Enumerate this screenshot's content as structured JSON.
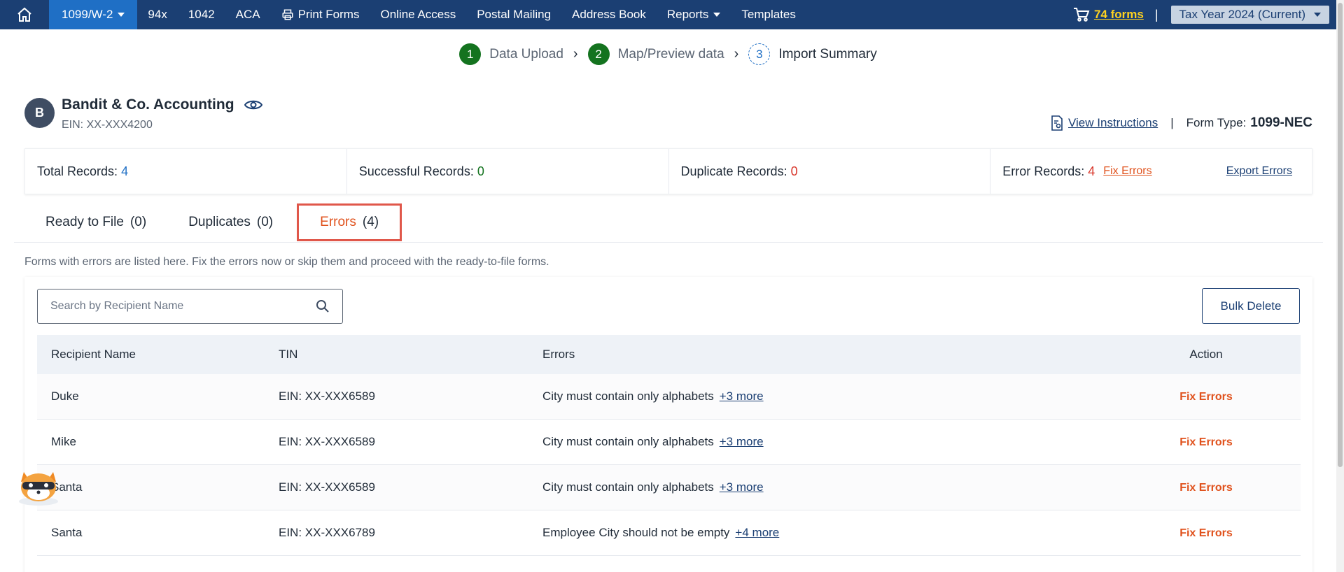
{
  "nav": {
    "active_menu": "1099/W-2",
    "items": [
      "94x",
      "1042",
      "ACA",
      "Print Forms",
      "Online Access",
      "Postal Mailing",
      "Address Book",
      "Reports",
      "Templates"
    ],
    "cart_label": "74 forms",
    "separator": "|",
    "tax_year": "Tax Year 2024 (Current)"
  },
  "stepper": {
    "steps": [
      {
        "number": "1",
        "label": "Data Upload"
      },
      {
        "number": "2",
        "label": "Map/Preview data"
      },
      {
        "number": "3",
        "label": "Import Summary"
      }
    ],
    "arrow": "›"
  },
  "company": {
    "initial": "B",
    "name": "Bandit & Co. Accounting",
    "ein": "EIN: XX-XXX4200"
  },
  "instructions": {
    "link": "View Instructions",
    "separator": "|",
    "form_type_label": "Form Type:",
    "form_type_value": "1099-NEC"
  },
  "stats": {
    "total_label": "Total Records:",
    "total_value": "4",
    "successful_label": "Successful Records:",
    "successful_value": "0",
    "duplicate_label": "Duplicate Records:",
    "duplicate_value": "0",
    "error_label": "Error Records:",
    "error_value": "4",
    "fix_errors": "Fix Errors",
    "export_errors": "Export Errors"
  },
  "tabs": [
    {
      "label": "Ready to File",
      "count": "(0)"
    },
    {
      "label": "Duplicates",
      "count": "(0)"
    },
    {
      "label": "Errors",
      "count": "(4)"
    }
  ],
  "description": "Forms with errors are listed here. Fix the errors now or skip them and proceed with the ready-to-file forms.",
  "search": {
    "placeholder": "Search by Recipient Name"
  },
  "bulk_delete": "Bulk Delete",
  "table": {
    "headers": [
      "Recipient Name",
      "TIN",
      "Errors",
      "Action"
    ],
    "rows": [
      {
        "name": "Duke",
        "tin": "EIN: XX-XXX6589",
        "error": "City must contain only alphabets",
        "more": "+3 more",
        "action": "Fix Errors"
      },
      {
        "name": "Mike",
        "tin": "EIN: XX-XXX6589",
        "error": "City must contain only alphabets",
        "more": "+3 more",
        "action": "Fix Errors"
      },
      {
        "name": "Santa",
        "tin": "EIN: XX-XXX6589",
        "error": "City must contain only alphabets",
        "more": "+3 more",
        "action": "Fix Errors"
      },
      {
        "name": "Santa",
        "tin": "EIN: XX-XXX6789",
        "error": "Employee City should not be empty",
        "more": "+4 more",
        "action": "Fix Errors"
      }
    ]
  },
  "colors": {
    "nav_bg": "#1b3f73",
    "nav_active": "#1f6fc5",
    "step_done": "#14731f",
    "accent_orange": "#e0521d",
    "error_red": "#d8352a"
  },
  "icons": {
    "home": "home-icon",
    "cart": "cart-icon",
    "printer": "printer-icon",
    "eye": "eye-icon",
    "instructions": "document-icon",
    "search": "search-icon",
    "mascot": "mascot-icon"
  }
}
